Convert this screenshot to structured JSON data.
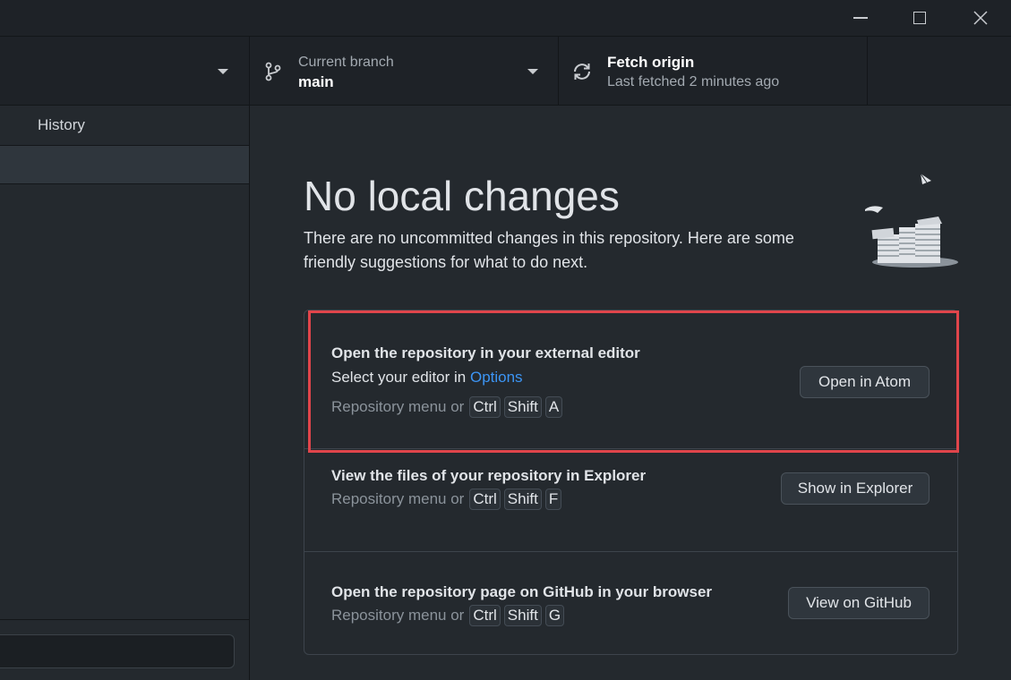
{
  "window": {
    "controls": [
      "minimize-icon",
      "maximize-icon",
      "close-icon"
    ]
  },
  "toolbar": {
    "branch_label": "Current branch",
    "branch_value": "main",
    "fetch_title": "Fetch origin",
    "fetch_subtitle": "Last fetched 2 minutes ago"
  },
  "sidebar": {
    "tab_history": "History"
  },
  "main": {
    "heading": "No local changes",
    "description": "There are no uncommitted changes in this repository. Here are some friendly suggestions for what to do next.",
    "actions": [
      {
        "title": "Open the repository in your external editor",
        "line_prefix": "Select your editor in ",
        "line_link": "Options",
        "shortcut_prefix": "Repository menu or",
        "keys": [
          "Ctrl",
          "Shift",
          "A"
        ],
        "button": "Open in Atom"
      },
      {
        "title": "View the files of your repository in Explorer",
        "shortcut_prefix": "Repository menu or",
        "keys": [
          "Ctrl",
          "Shift",
          "F"
        ],
        "button": "Show in Explorer"
      },
      {
        "title": "Open the repository page on GitHub in your browser",
        "shortcut_prefix": "Repository menu or",
        "keys": [
          "Ctrl",
          "Shift",
          "G"
        ],
        "button": "View on GitHub"
      }
    ]
  },
  "colors": {
    "background": "#24292e",
    "toolbar": "#1e2227",
    "link": "#3c95f5",
    "highlight": "#e0454b"
  }
}
